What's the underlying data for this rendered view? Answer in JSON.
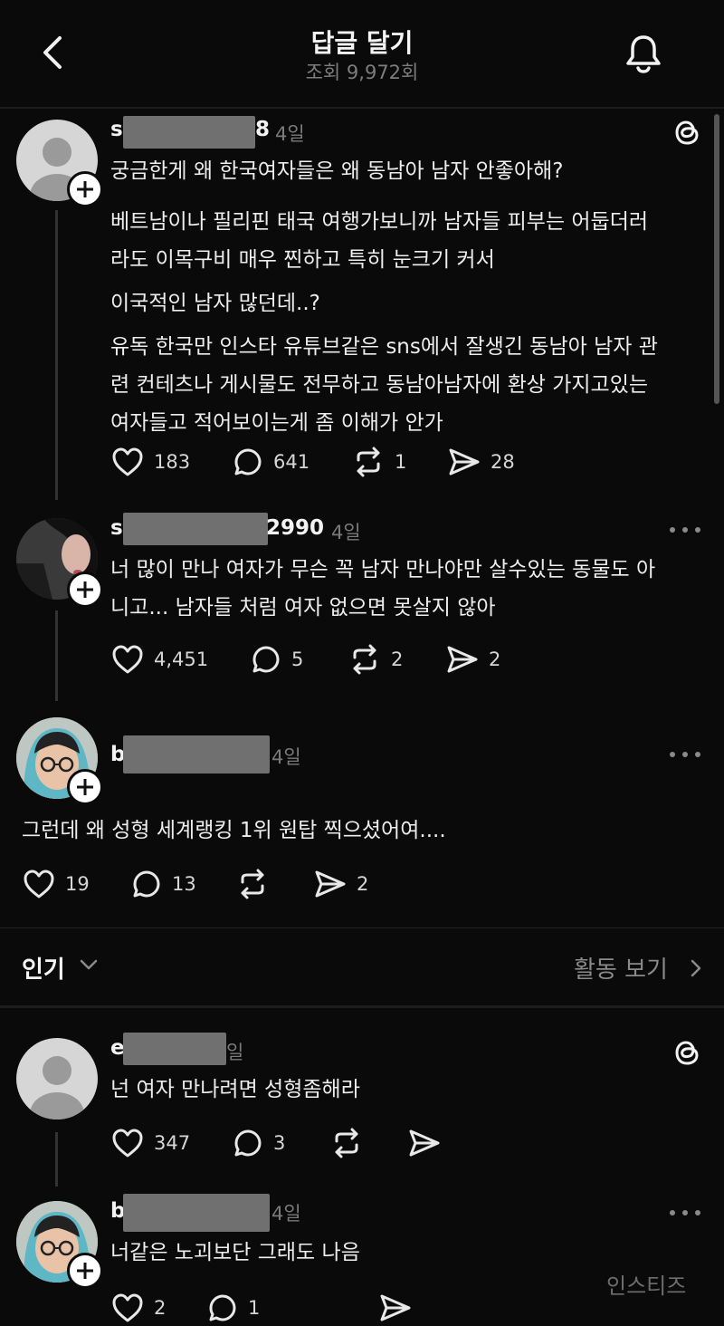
{
  "header": {
    "title": "답글 달기",
    "views": "조회 9,972회"
  },
  "posts": [
    {
      "user_prefix": "s",
      "user_suffix": "8",
      "time": "4일",
      "lines": [
        "궁금한게 왜 한국여자들은 왜 동남아 남자 안좋아해?",
        "베트남이나 필리핀 태국 여행가보니까 남자들 피부는 어둡더러",
        "라도 이목구비 매우 찐하고 특히 눈크기 커서",
        "이국적인 남자 많던데..?",
        "유독 한국만 인스타 유튜브같은 sns에서 잘생긴 동남아 남자 관",
        "련 컨테츠나 게시물도 전무하고 동남아남자에 환상 가지고있는",
        "여자들고 적어보이는게 좀 이해가 안가"
      ],
      "likes": "183",
      "replies": "641",
      "reposts": "1",
      "shares": "28"
    },
    {
      "user_prefix": "s",
      "user_suffix": "2990",
      "time": "4일",
      "lines": [
        "너 많이 만나 여자가 무슨 꼭 남자 만나야만 살수있는 동물도 아",
        "니고... 남자들 처럼 여자 없으면 못살지 않아"
      ],
      "likes": "4,451",
      "replies": "5",
      "reposts": "2",
      "shares": "2"
    },
    {
      "user_prefix": "b",
      "user_suffix": "",
      "time": "4일",
      "lines": [
        "그런데 왜 성형 세계랭킹 1위 원탑 찍으셨어여...."
      ],
      "likes": "19",
      "replies": "13",
      "reposts": "",
      "shares": "2"
    }
  ],
  "sort": {
    "label": "인기",
    "activity": "활동 보기"
  },
  "replies": [
    {
      "user_prefix": "e",
      "time": "일",
      "lines": [
        "넌 여자 만나려면 성형좀해라"
      ],
      "likes": "347",
      "replies": "3"
    },
    {
      "user_prefix": "b",
      "time": "4일",
      "lines": [
        "너같은 노괴보단 그래도 나음"
      ],
      "likes": "2",
      "replies": "1"
    }
  ],
  "watermark": "인스티즈",
  "icons": [
    "back-icon",
    "bell-icon",
    "threads-logo-icon",
    "more-icon",
    "heart-icon",
    "comment-icon",
    "repost-icon",
    "share-icon",
    "plus-icon",
    "chevron-down-icon",
    "chevron-right-icon"
  ]
}
